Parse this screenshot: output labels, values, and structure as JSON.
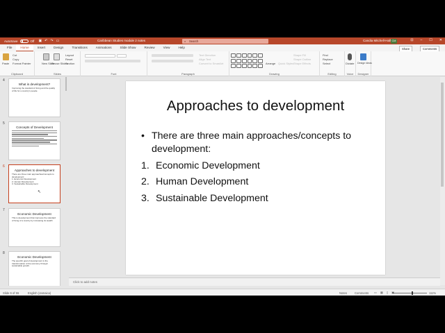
{
  "titlebar": {
    "autosave_label": "AutoSave",
    "autosave_state": "Off",
    "doc_title": "Caribbean Studies module 2 notes",
    "search_placeholder": "Search",
    "user_name": "Candia Mitchell-Hall",
    "user_initials": "CM"
  },
  "tabs": [
    "File",
    "Home",
    "Insert",
    "Design",
    "Transitions",
    "Animations",
    "Slide Show",
    "Review",
    "View",
    "Help"
  ],
  "active_tab": "Home",
  "share_label": "Share",
  "comments_label": "Comments",
  "ribbon": {
    "clipboard": {
      "paste": "Paste",
      "cut": "Cut",
      "copy": "Copy",
      "format_painter": "Format Painter",
      "label": "Clipboard"
    },
    "slides": {
      "new_slide": "New Slide",
      "reuse": "Reuse Slides",
      "layout": "Layout",
      "reset": "Reset",
      "section": "Section",
      "label": "Slides"
    },
    "font": {
      "label": "Font"
    },
    "paragraph": {
      "text_direction": "Text Direction",
      "align_text": "Align Text",
      "convert_smartart": "Convert to SmartArt",
      "label": "Paragraph"
    },
    "drawing": {
      "arrange": "Arrange",
      "quick_styles": "Quick Styles",
      "shape_fill": "Shape Fill",
      "shape_outline": "Shape Outline",
      "shape_effects": "Shape Effects",
      "label": "Drawing"
    },
    "editing": {
      "find": "Find",
      "replace": "Replace",
      "select": "Select",
      "label": "Editing"
    },
    "voice": {
      "dictate": "Dictate",
      "label": "Voice"
    },
    "designer": {
      "design_ideas": "Design Ideas",
      "label": "Designer"
    }
  },
  "thumbnails": [
    {
      "number": "4",
      "title": "What is development?",
      "text": "Improving the standard of living and the quality of life for a country's people"
    },
    {
      "number": "5",
      "title": "Concepts of Development",
      "text": ""
    },
    {
      "number": "6",
      "title": "Approaches to development",
      "lines": [
        "There are three main approaches/concepts to development:",
        "1. Economic Development",
        "2. Human Development",
        "3. Sustainable Development"
      ]
    },
    {
      "number": "7",
      "title": "Economic Development",
      "text": "This is development that improves the standard of living of a country by increasing its wealth"
    },
    {
      "number": "8",
      "title": "Economic Development",
      "text": "The specific goal of development is the transformation of the economy through sustainable growth."
    }
  ],
  "slide": {
    "title": "Approaches to development",
    "bullet": "There are three main approaches/concepts to development:",
    "items": [
      {
        "num": "1.",
        "text": "Economic Development"
      },
      {
        "num": "2.",
        "text": "Human Development"
      },
      {
        "num": "3.",
        "text": "Sustainable Development"
      }
    ]
  },
  "notes_placeholder": "Click to add notes",
  "status": {
    "slide_info": "Slide 6 of 55",
    "language": "English (Jamaica)",
    "notes": "Notes",
    "comments": "Comments",
    "zoom": "111%"
  },
  "colors": {
    "accent": "#b7472a",
    "selected_thumb": "#c43e1c"
  }
}
